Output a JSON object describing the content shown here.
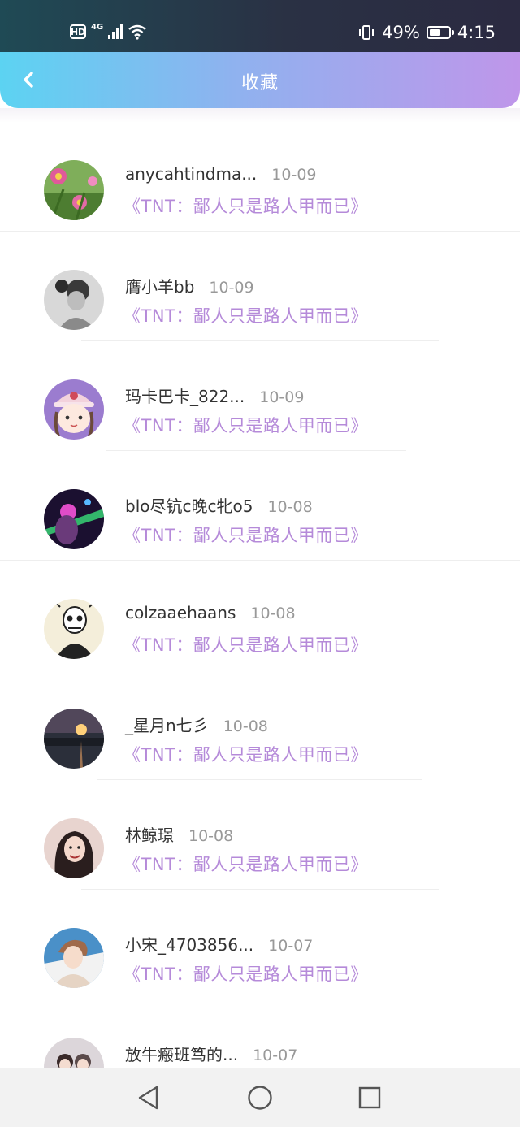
{
  "status_bar": {
    "hd": "HD",
    "network": "4G",
    "battery_percent": "49%",
    "time": "4:15",
    "battery_level": 0.49
  },
  "header": {
    "title": "收藏",
    "back_icon": "chevron-left-icon"
  },
  "favorites": [
    {
      "user": "anycahtindma...",
      "date": "10-09",
      "title": "《TNT：鄙人只是路人甲而已》",
      "avatar": "lotus-flowers"
    },
    {
      "user": "膺小羊bb",
      "date": "10-09",
      "title": "《TNT：鄙人只是路人甲而已》",
      "avatar": "grayscale-girl"
    },
    {
      "user": "玛卡巴卡_822...",
      "date": "10-09",
      "title": "《TNT：鄙人只是路人甲而已》",
      "avatar": "cartoon-girl-hat"
    },
    {
      "user": "blo尽钪c晚c牝o5",
      "date": "10-08",
      "title": "《TNT：鄙人只是路人甲而已》",
      "avatar": "neon-light-portrait"
    },
    {
      "user": "colzaaehaans",
      "date": "10-08",
      "title": "《TNT：鄙人只是路人甲而已》",
      "avatar": "skull-sketch"
    },
    {
      "user": "_星月n七彡",
      "date": "10-08",
      "title": "《TNT：鄙人只是路人甲而已》",
      "avatar": "sunset-lake"
    },
    {
      "user": "林鲸璟",
      "date": "10-08",
      "title": "《TNT：鄙人只是路人甲而已》",
      "avatar": "smiling-girl"
    },
    {
      "user": "小宋_4703856...",
      "date": "10-07",
      "title": "《TNT：鄙人只是路人甲而已》",
      "avatar": "boy-portrait"
    },
    {
      "user": "放牛瘢班笃的...",
      "date": "10-07",
      "title": "",
      "avatar": "couple-photo"
    }
  ],
  "nav_bar": {
    "back_icon": "triangle-back-icon",
    "home_icon": "circle-home-icon",
    "recents_icon": "square-recents-icon"
  },
  "colors": {
    "header_gradient_start": "#5cd3f2",
    "header_gradient_end": "#bf96ea",
    "title_link": "#b58ad9",
    "date_gray": "#999999"
  }
}
